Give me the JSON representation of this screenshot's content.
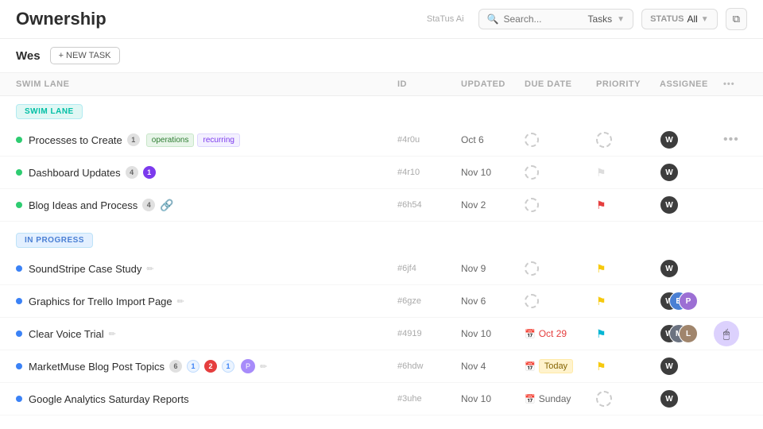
{
  "header": {
    "title": "Ownership",
    "search_placeholder": "Search...",
    "tasks_label": "Tasks",
    "status_label": "STATUS",
    "all_label": "All",
    "filter_icon": "▼",
    "status_ai": "StaTus Ai"
  },
  "subheader": {
    "user": "Wes",
    "new_task_label": "+ NEW TASK"
  },
  "table_columns": {
    "swimlane": "SWIM LANE",
    "id": "ID",
    "updated": "UPDATED",
    "due_date": "DUE DATE",
    "priority": "PRIORITY",
    "assignee": "ASSIGNEE"
  },
  "sections": [
    {
      "id": "swim_lane",
      "badge_label": "SWIM LANE",
      "badge_type": "swim-lane",
      "tasks": [
        {
          "id": "task-1",
          "name": "Processes to Create",
          "count_badge": "1",
          "count_type": "gray",
          "tags": [
            "operations",
            "recurring"
          ],
          "task_id": "#4r0u",
          "updated": "Oct 6",
          "due_date": "",
          "priority": "dashed",
          "status_color": "green",
          "assignee_type": "dark"
        },
        {
          "id": "task-2",
          "name": "Dashboard Updates",
          "count_badge": "4",
          "count_type": "gray",
          "extra_badge": "1",
          "extra_type": "purple",
          "tags": [],
          "task_id": "#4r10",
          "updated": "Nov 10",
          "due_date": "",
          "priority": "gray",
          "status_color": "green",
          "assignee_type": "dark"
        },
        {
          "id": "task-3",
          "name": "Blog Ideas and Process",
          "count_badge": "4",
          "count_type": "gray",
          "tags": [],
          "task_id": "#6h54",
          "updated": "Nov 2",
          "due_date": "",
          "priority": "red",
          "status_color": "green",
          "assignee_type": "dark"
        }
      ]
    },
    {
      "id": "in_progress",
      "badge_label": "IN PROGRESS",
      "badge_type": "in-progress",
      "tasks": [
        {
          "id": "task-4",
          "name": "SoundStripe Case Study",
          "has_edit": true,
          "tags": [],
          "task_id": "#6jf4",
          "updated": "Nov 9",
          "due_date": "",
          "priority": "yellow",
          "status_color": "blue",
          "assignee_type": "dark"
        },
        {
          "id": "task-5",
          "name": "Graphics for Trello Import Page",
          "has_edit": true,
          "tags": [],
          "task_id": "#6gze",
          "updated": "Nov 6",
          "due_date": "",
          "priority": "yellow",
          "status_color": "blue",
          "assignee_type": "multi"
        },
        {
          "id": "task-6",
          "name": "Clear Voice Trial",
          "has_edit": true,
          "tags": [],
          "task_id": "#4919",
          "updated": "Nov 10",
          "due_date": "Oct 29",
          "due_overdue": true,
          "priority": "cyan",
          "status_color": "blue",
          "assignee_type": "multi2",
          "has_cursor": true
        },
        {
          "id": "task-7",
          "name": "MarketMuse Blog Post Topics",
          "count_badge": "6",
          "count_type": "gray",
          "extra_badges": [
            "1",
            "2",
            "1"
          ],
          "has_edit": true,
          "has_avatar_extra": true,
          "tags": [],
          "task_id": "#6hdw",
          "updated": "Nov 4",
          "due_date": "Today",
          "due_today": true,
          "priority": "yellow",
          "status_color": "blue",
          "assignee_type": "dark"
        },
        {
          "id": "task-8",
          "name": "Google Analytics Saturday Reports",
          "tags": [],
          "task_id": "#3uhe",
          "updated": "Nov 10",
          "due_date": "Sunday",
          "priority": "dashed",
          "status_color": "blue",
          "assignee_type": "dark"
        }
      ]
    }
  ]
}
